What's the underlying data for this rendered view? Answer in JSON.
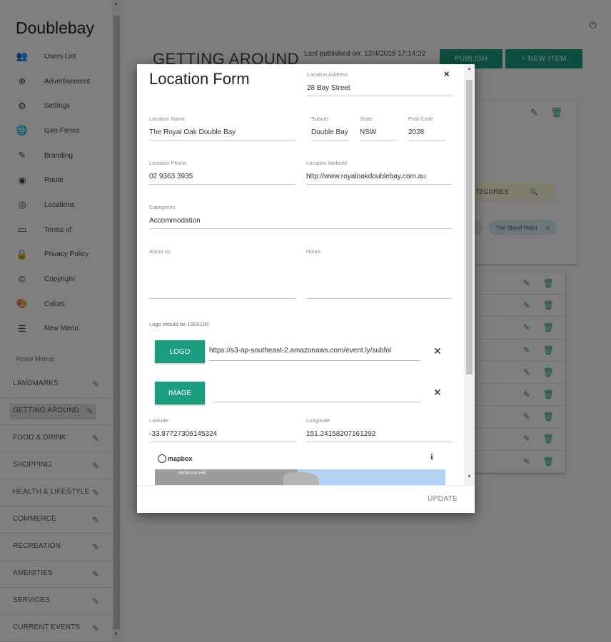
{
  "app": {
    "brand": "Doublebay",
    "active_menus_label": "Active Menus"
  },
  "menu": [
    {
      "icon": "people-icon",
      "glyph": "👥",
      "label": "Users List"
    },
    {
      "icon": "plus-circle-icon",
      "glyph": "⊕",
      "label": "Advertisement"
    },
    {
      "icon": "gear-icon",
      "glyph": "⚙",
      "label": "Settings"
    },
    {
      "icon": "globe-icon",
      "glyph": "🌐",
      "label": "Geo Fence"
    },
    {
      "icon": "brush-icon",
      "glyph": "✎",
      "label": "Branding"
    },
    {
      "icon": "route-icon",
      "glyph": "◉",
      "label": "Route"
    },
    {
      "icon": "location-icon",
      "glyph": "◎",
      "label": "Locations"
    },
    {
      "icon": "label-icon",
      "glyph": "▭",
      "label": "Terms of"
    },
    {
      "icon": "lock-icon",
      "glyph": "🔒",
      "label": "Privacy Policy"
    },
    {
      "icon": "copyright-icon",
      "glyph": "©",
      "label": "Copyright"
    },
    {
      "icon": "palette-icon",
      "glyph": "🎨",
      "label": "Colors"
    },
    {
      "icon": "new-menu-icon",
      "glyph": "☰",
      "label": "New Menu"
    }
  ],
  "categories": [
    {
      "label": "LANDMARKS"
    },
    {
      "label": "GETTING AROUND"
    },
    {
      "label": "FOOD & DRINK"
    },
    {
      "label": "SHOPPING"
    },
    {
      "label": "HEALTH & LIFESTYLE"
    },
    {
      "label": "COMMERCE"
    },
    {
      "label": "RECREATION"
    },
    {
      "label": "AMENITIES"
    },
    {
      "label": "SERVICES"
    },
    {
      "label": "CURRENT EVENTS"
    }
  ],
  "main": {
    "page_title": "GETTING AROUND",
    "last_published": "Last published on: 12/4/2018 17:14:22",
    "publish_label": "PUBLISH",
    "new_item_label": "+ NEW ITEM",
    "categories_search": "TEGORIES",
    "chip_label": "The Sheaf Hotel",
    "chip_remove": "×",
    "row_count": 9
  },
  "modal": {
    "title": "Location Form",
    "close": "×",
    "location_address": {
      "label": "Location Address",
      "value": "28 Bay Street"
    },
    "location_name": {
      "label": "Location Name",
      "value": "The Royal Oak Double Bay"
    },
    "suburb": {
      "label": "Suburb",
      "value": "Double Bay"
    },
    "state": {
      "label": "State",
      "value": "NSW"
    },
    "post_code": {
      "label": "Post Code",
      "value": "2028"
    },
    "location_phone": {
      "label": "Location Phone",
      "value": "02 9363 3935"
    },
    "location_website": {
      "label": "Location Website",
      "value": "http://www.royaloakdoublebay.com.au"
    },
    "categories": {
      "label": "Categories",
      "value": "Accommodation"
    },
    "about_us": {
      "label": "About us",
      "value": ""
    },
    "hours": {
      "label": "Hours",
      "value": ""
    },
    "logo_hint": "Logo should be 100X100",
    "logo_button": "LOGO",
    "logo_url": "https://s3-ap-southeast-2.amazonaws.com/event.ly/subfol",
    "image_button": "IMAGE",
    "image_url": "",
    "latitude": {
      "label": "Latitude",
      "value": "-33.87727306145324"
    },
    "longitude": {
      "label": "Longitude",
      "value": "151.24158207161292"
    },
    "map_brand": "mapbox",
    "map_info": "ℹ",
    "map_place": "Bellevue Hill",
    "update_label": "UPDATE"
  },
  "colors": {
    "accent": "#1a9d80",
    "overlay": "rgba(0,0,0,0.5)"
  }
}
